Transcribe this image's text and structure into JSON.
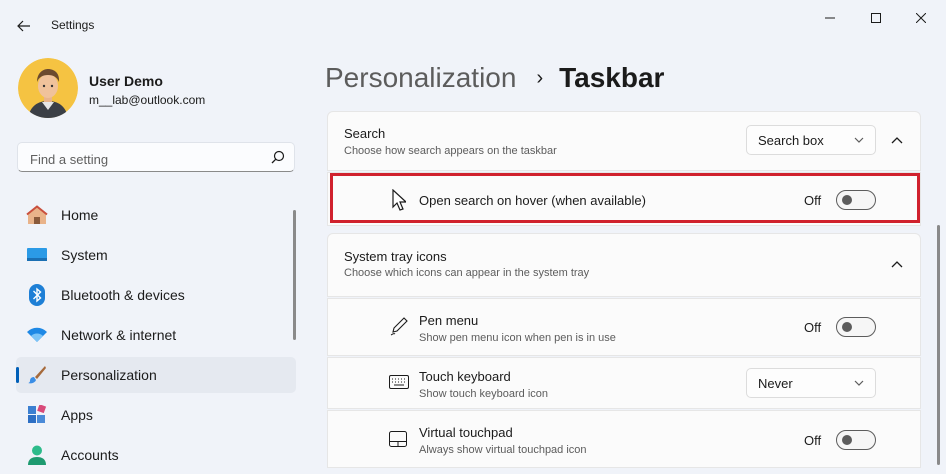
{
  "window": {
    "title": "Settings",
    "controls": {
      "minimize": "minimize-icon",
      "maximize": "maximize-icon",
      "close": "close-icon"
    }
  },
  "profile": {
    "name": "User Demo",
    "email": "m__lab@outlook.com"
  },
  "search": {
    "placeholder": "Find a setting"
  },
  "sidebar": {
    "items": [
      {
        "label": "Home",
        "icon": "home-icon"
      },
      {
        "label": "System",
        "icon": "system-icon"
      },
      {
        "label": "Bluetooth & devices",
        "icon": "bluetooth-icon"
      },
      {
        "label": "Network & internet",
        "icon": "network-icon"
      },
      {
        "label": "Personalization",
        "icon": "brush-icon",
        "selected": true
      },
      {
        "label": "Apps",
        "icon": "apps-icon"
      },
      {
        "label": "Accounts",
        "icon": "accounts-icon"
      }
    ]
  },
  "header": {
    "parent": "Personalization",
    "separator": "›",
    "current": "Taskbar"
  },
  "search_section": {
    "title": "Search",
    "subtitle": "Choose how search appears on the taskbar",
    "dropdown_value": "Search box",
    "hover_option": {
      "label": "Open search on hover (when available)",
      "state": "Off"
    }
  },
  "tray_section": {
    "title": "System tray icons",
    "subtitle": "Choose which icons can appear in the system tray",
    "items": [
      {
        "title": "Pen menu",
        "subtitle": "Show pen menu icon when pen is in use",
        "state": "Off",
        "icon": "pen-icon"
      },
      {
        "title": "Touch keyboard",
        "subtitle": "Show touch keyboard icon",
        "dropdown_value": "Never",
        "icon": "keyboard-icon"
      },
      {
        "title": "Virtual touchpad",
        "subtitle": "Always show virtual touchpad icon",
        "state": "Off",
        "icon": "touchpad-icon"
      }
    ]
  },
  "colors": {
    "accent": "#005fb8",
    "highlight_box": "#d0212d",
    "window_bg": "#f0f3f9",
    "card_bg": "#fbfbfb"
  }
}
